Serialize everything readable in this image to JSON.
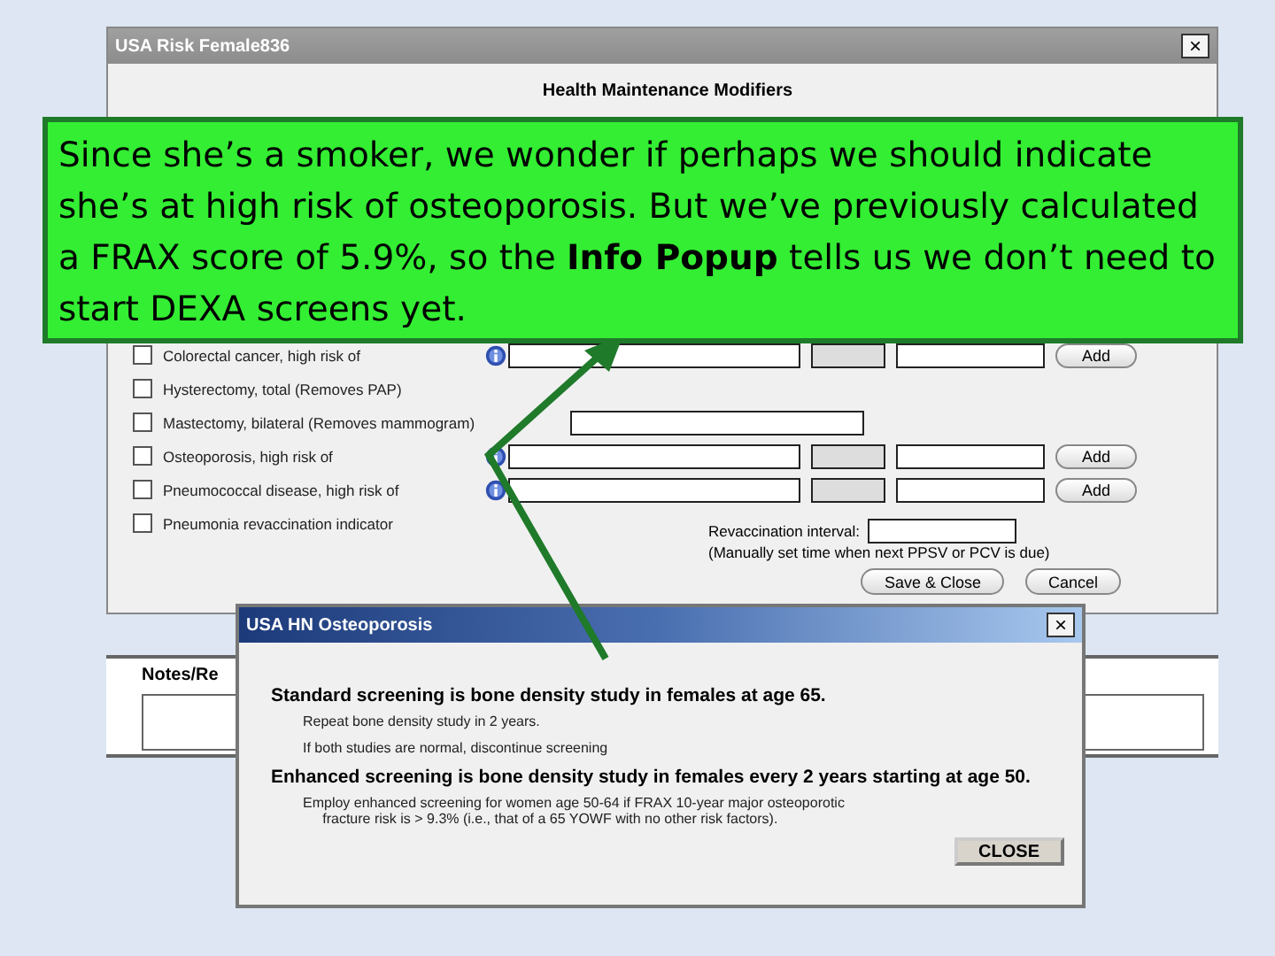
{
  "main_window": {
    "title": "USA Risk Female836",
    "heading": "Health Maintenance Modifiers",
    "rows": [
      {
        "kind": "diagnosis",
        "label": "Colorectal cancer, high risk of",
        "checked": false,
        "add_button": "Add"
      },
      {
        "kind": "plain",
        "label": "Hysterectomy, total (Removes PAP)",
        "checked": false
      },
      {
        "kind": "single_field",
        "label": "Mastectomy, bilateral (Removes mammogram)",
        "checked": false
      },
      {
        "kind": "diagnosis",
        "label": "Osteoporosis, high risk of",
        "checked": false,
        "add_button": "Add"
      },
      {
        "kind": "diagnosis",
        "label": "Pneumococcal disease, high risk of",
        "checked": false,
        "add_button": "Add"
      },
      {
        "kind": "plain",
        "label": "Pneumonia revaccination indicator",
        "checked": false
      }
    ],
    "revaccination_label": "Revaccination interval:",
    "revaccination_note": "(Manually set time when next PPSV or PCV is due)",
    "buttons": [
      "Save & Close",
      "Cancel"
    ]
  },
  "notes": {
    "label": "Notes/Re"
  },
  "popup": {
    "title": "USA HN Osteoporosis",
    "close_glyph": "×",
    "sections": [
      {
        "heading": "Standard screening is bone density study in females at age 65.",
        "lines": [
          "Repeat bone density study in 2 years.",
          "If both studies are normal, discontinue screening"
        ]
      },
      {
        "heading": "Enhanced screening is bone density study in females every 2 years starting at age 50.",
        "lines": [
          "Employ enhanced screening for women age 50-64 if FRAX 10-year major osteoporotic\n     fracture risk is > 9.3% (i.e., that of a 65 YOWF with no other risk factors)."
        ]
      }
    ],
    "button": "CLOSE"
  },
  "main_close_glyph": "×",
  "callout": {
    "text": "Since she’s a smoker, we wonder if perhaps we should indicate she’s at high risk of osteoporosis.  But we’ve previously calculated a FRAX score of 5.9%, so the **Info Popup** tells us we don’t need to start DEXA screens yet."
  }
}
